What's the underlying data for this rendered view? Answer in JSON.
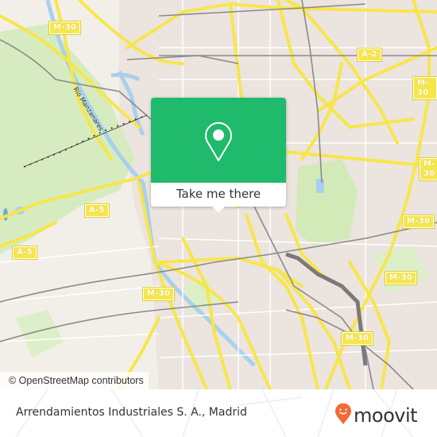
{
  "map": {
    "attribution": "© OpenStreetMap contributors",
    "colors": {
      "land": "#f2efe9",
      "urban": "#e8e0dc",
      "park": "#d6ecc0",
      "water": "#a9d0ec",
      "major_road": "#f7e64a",
      "rail": "#888888",
      "accent_green": "#1fba6b",
      "brand_orange": "#f26a35"
    },
    "road_labels": [
      {
        "id": "m30-nw",
        "text": "M-30"
      },
      {
        "id": "a2",
        "text": "A-2"
      },
      {
        "id": "m30-ne",
        "text": "M-30"
      },
      {
        "id": "m30-e1",
        "text": "M-30"
      },
      {
        "id": "m30-e2",
        "text": "M-30"
      },
      {
        "id": "a5-center",
        "text": "A-5"
      },
      {
        "id": "a5-west",
        "text": "A-5"
      },
      {
        "id": "m30-sw",
        "text": "M-30"
      },
      {
        "id": "m30-se",
        "text": "M-30"
      },
      {
        "id": "m30-s",
        "text": "M-30"
      }
    ],
    "river_label": "Río Manzanares"
  },
  "popup": {
    "icon": "location-pin-icon",
    "button_label": "Take me there"
  },
  "footer": {
    "place_name": "Arrendamientos Industriales S. A., Madrid",
    "brand": "moovit",
    "brand_icon": "moovit-smiley-pin-icon"
  }
}
